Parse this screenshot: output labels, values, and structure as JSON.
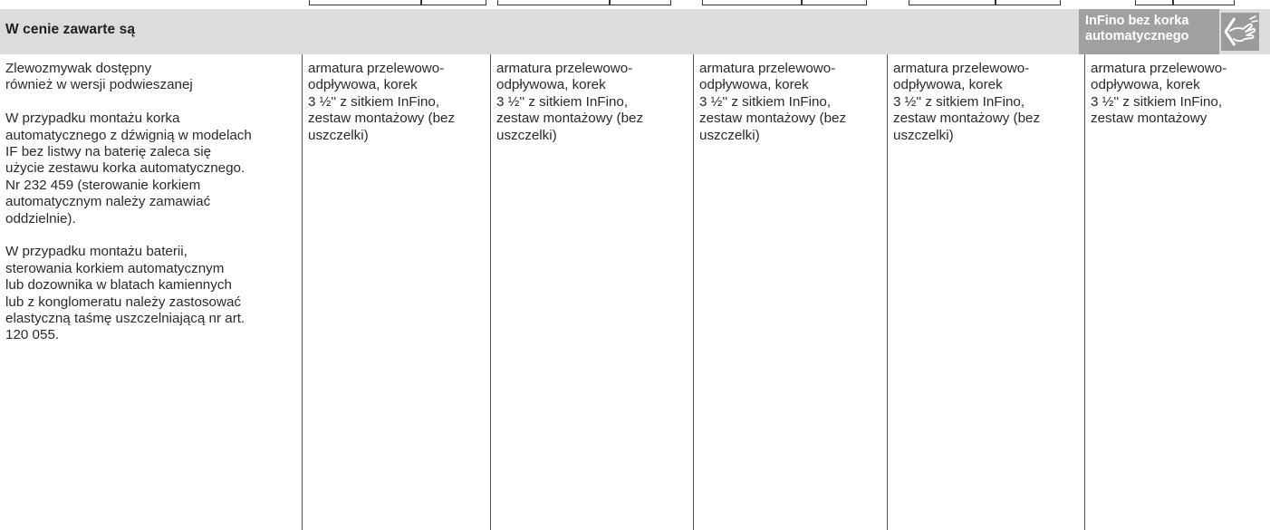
{
  "header": {
    "title": "W cenie zawarte są",
    "badge_line1": "InFino bez korka",
    "badge_line2": "automatycznego",
    "icon": "hand-touch-icon"
  },
  "columns": [
    {
      "paragraphs": [
        "Zlewozmywak dostępny\nrównież w wersji podwieszanej",
        "W przypadku montażu korka\nautomatycznego z dźwignią w modelach\nIF bez listwy na baterię zaleca się\nużycie zestawu korka automatycznego.\nNr 232 459 (sterowanie korkiem\nautomatycznym należy zamawiać\noddzielnie).",
        "W przypadku montażu baterii,\nsterowania korkiem automatycznym\nlub dozownika w blatach kamiennych\nlub z konglomeratu należy zastosować\nelastyczną taśmę uszczelniającą nr art.\n120 055."
      ]
    },
    {
      "text": "armatura przelewowo-\nodpływowa, korek\n3 ½'' z sitkiem InFino,\nzestaw montażowy (bez\nuszczelki)"
    },
    {
      "text": "armatura przelewowo-\nodpływowa, korek\n3 ½'' z sitkiem InFino,\nzestaw montażowy (bez\nuszczelki)"
    },
    {
      "text": "armatura przelewowo-\nodpływowa, korek\n3 ½'' z sitkiem InFino,\nzestaw montażowy (bez\nuszczelki)"
    },
    {
      "text": "armatura przelewowo-\nodpływowa, korek\n3 ½'' z sitkiem InFino,\nzestaw montażowy (bez\nuszczelki)"
    },
    {
      "text": "armatura przelewowo-\nodpływowa, korek\n3 ½'' z sitkiem InFino,\nzestaw montażowy"
    }
  ],
  "colors": {
    "header_bg": "#dcdcdc",
    "badge_bg": "#a0a0a0",
    "text": "#2a2a2a"
  }
}
